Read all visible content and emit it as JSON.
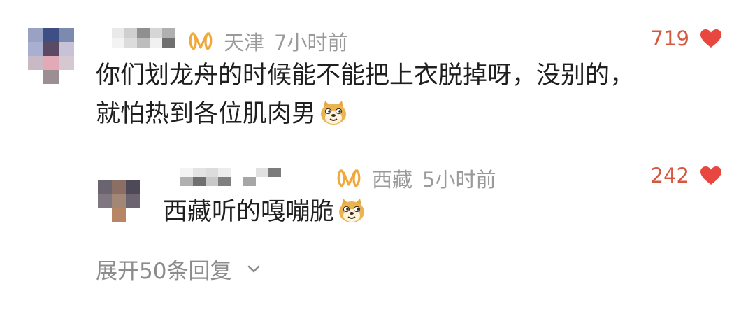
{
  "comments": [
    {
      "location": "天津",
      "time": "7小时前",
      "likes": "719",
      "text_line1": "你们划龙舟的时候能不能把上衣脱掉呀，没别的，",
      "text_line2": "就怕热到各位肌肉男",
      "emoji": "doge-face-icon"
    },
    {
      "location": "西藏",
      "time": "5小时前",
      "likes": "242",
      "text_line1": "西藏听的嘎嘣脆",
      "emoji": "doge-face-icon"
    }
  ],
  "expand_replies": {
    "label": "展开50条回复",
    "icon": "chevron-down-icon"
  },
  "colors": {
    "likes": "#d4573e",
    "heart": "#e8473f",
    "badge": "#f0a83a",
    "meta": "#9a9a9a",
    "text": "#1f1f1f"
  }
}
